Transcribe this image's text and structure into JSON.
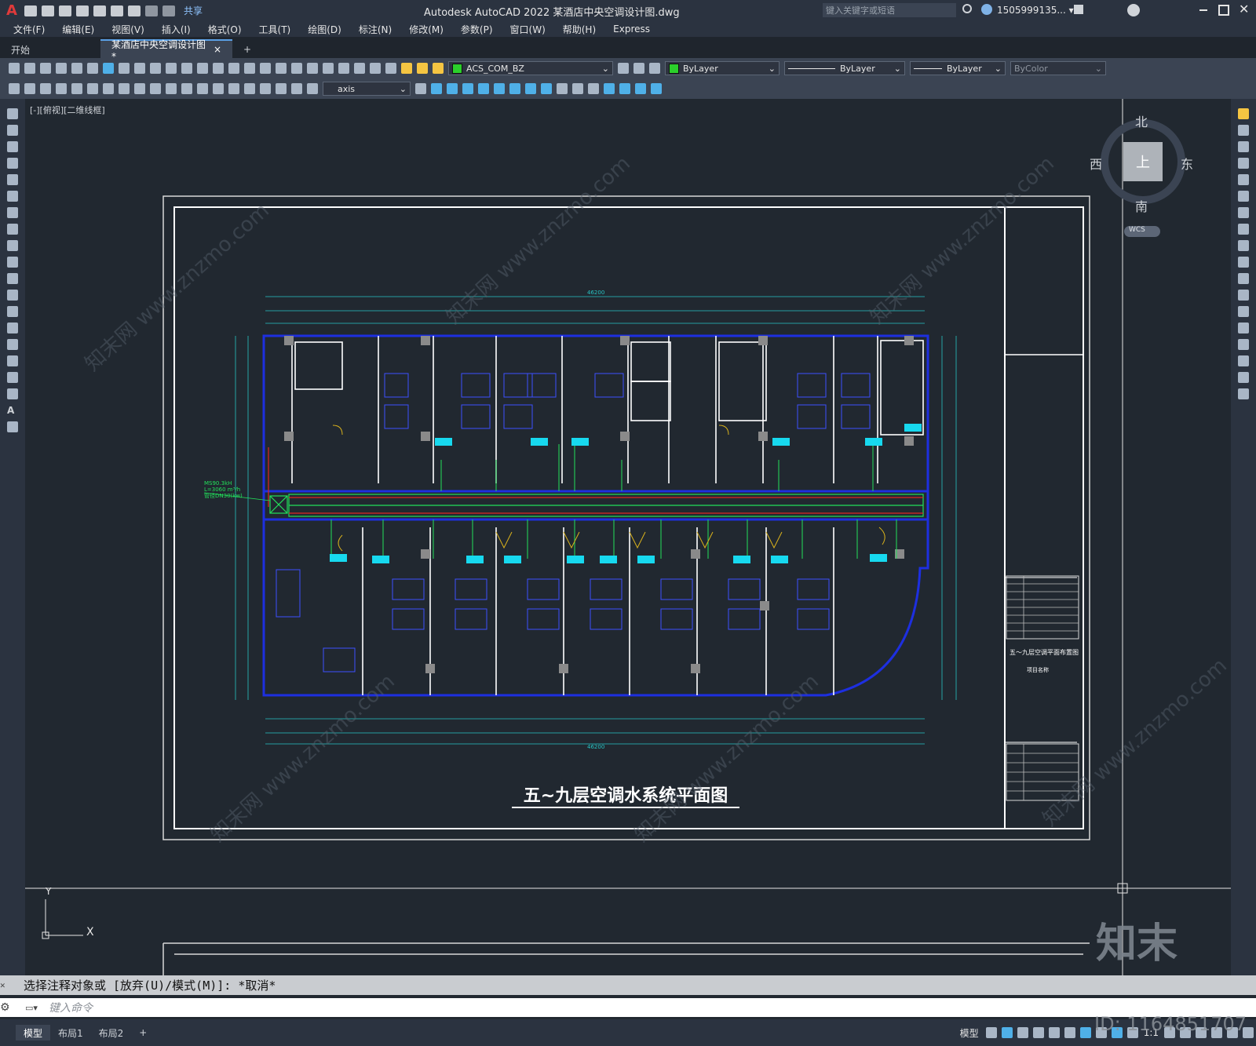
{
  "title_bar": {
    "title": "Autodesk AutoCAD 2022    某酒店中央空调设计图.dwg",
    "share_label": "共享",
    "search_placeholder": "键入关键字或短语",
    "user": "1505999135... ▾",
    "app_logo": "A"
  },
  "menu": [
    "文件(F)",
    "编辑(E)",
    "视图(V)",
    "插入(I)",
    "格式(O)",
    "工具(T)",
    "绘图(D)",
    "标注(N)",
    "修改(M)",
    "参数(P)",
    "窗口(W)",
    "帮助(H)",
    "Express"
  ],
  "doc_tabs": {
    "start": "开始",
    "active": "某酒店中央空调设计图*",
    "close": "×",
    "add": "+"
  },
  "toolbar": {
    "layer_name": "ACS_COM_BZ",
    "layer_color": "#2bd02b",
    "color": "ByLayer",
    "linetype": "ByLayer",
    "lineweight": "ByLayer",
    "plotstyle": "ByColor",
    "dimstyle": "axis"
  },
  "viewport": {
    "label": "[-][俯视][二维线框]"
  },
  "viewcube": {
    "north": "北",
    "south": "南",
    "east": "东",
    "west": "西",
    "top": "上",
    "wcs": "WCS"
  },
  "drawing": {
    "title": "五~九层空调水系统平面图",
    "overall_dim_top": "46200",
    "overall_dim_bottom": "46200",
    "title_block_text": "五～九层空调平面布置图",
    "title_block_sub": "项目名称",
    "callout": [
      "MS90.3kH",
      "L=3060 m³/h",
      "管径DN30(kw)"
    ]
  },
  "ucs": {
    "x": "X",
    "y": "Y"
  },
  "command": {
    "history": "选择注释对象或 [放弃(U)/模式(M)]: *取消*",
    "placeholder": "键入命令"
  },
  "layout_tabs": [
    "模型",
    "布局1",
    "布局2",
    "+"
  ],
  "status": {
    "model": "模型",
    "scale": "1:1"
  },
  "watermark": {
    "logo": "知末",
    "id": "ID: 1164851707",
    "text": "知末网 www.znzmo.com"
  }
}
